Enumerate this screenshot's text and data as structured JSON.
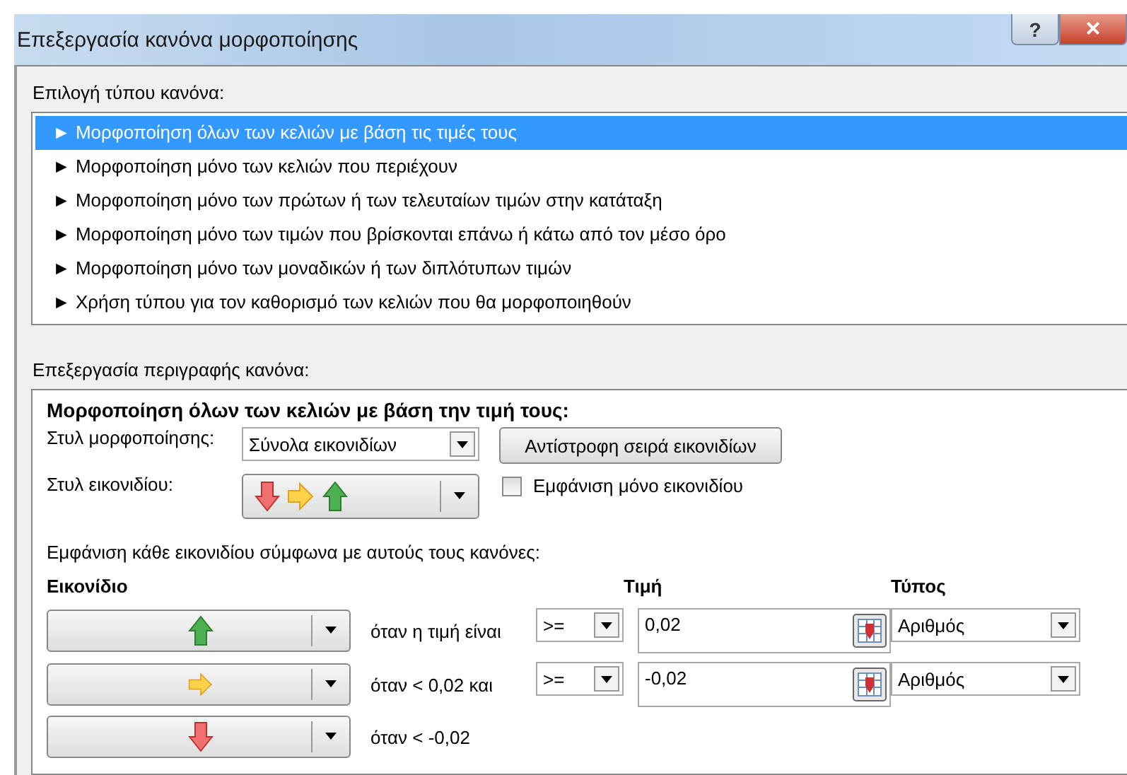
{
  "window": {
    "title": "Επεξεργασία κανόνα μορφοποίησης",
    "help": "?",
    "close": "×"
  },
  "rule_type": {
    "label": "Επιλογή τύπου κανόνα:",
    "items": [
      {
        "label": "► Μορφοποίηση όλων των κελιών με βάση τις τιμές τους",
        "selected": true
      },
      {
        "label": "► Μορφοποίηση μόνο των κελιών που περιέχουν",
        "selected": false
      },
      {
        "label": "► Μορφοποίηση μόνο των πρώτων ή των τελευταίων τιμών στην κατάταξη",
        "selected": false
      },
      {
        "label": "► Μορφοποίηση μόνο των τιμών που βρίσκονται επάνω ή κάτω από τον μέσο όρο",
        "selected": false
      },
      {
        "label": "► Μορφοποίηση μόνο των μοναδικών ή των διπλότυπων τιμών",
        "selected": false
      },
      {
        "label": "► Χρήση τύπου για τον καθορισμό των κελιών που θα μορφοποιηθούν",
        "selected": false
      }
    ]
  },
  "description": {
    "label": "Επεξεργασία περιγραφής κανόνα:",
    "heading": "Μορφοποίηση όλων των κελιών με βάση την τιμή τους:",
    "format_style": {
      "label": "Στυλ μορφοποίησης:",
      "value": "Σύνολα εικονιδίων"
    },
    "reverse_button": "Αντίστροφη σειρά εικονιδίων",
    "icon_style": {
      "label": "Στυλ εικονιδίου:"
    },
    "icon_only": {
      "label": "Εμφάνιση μόνο εικονιδίου",
      "checked": false
    },
    "rules_caption": "Εμφάνιση κάθε εικονιδίου σύμφωνα με αυτούς τους κανόνες:",
    "columns": [
      "Εικονίδιο",
      "Τιμή",
      "Τύπος"
    ],
    "rules": [
      {
        "kind": "up",
        "condition": "όταν η τιμή είναι",
        "operator": ">=",
        "value": "0,02",
        "type": "Αριθμός"
      },
      {
        "kind": "right",
        "condition": "όταν < 0,02 και",
        "operator": ">=",
        "value": "-0,02",
        "type": "Αριθμός"
      },
      {
        "kind": "down",
        "condition": "όταν < -0,02"
      }
    ]
  }
}
